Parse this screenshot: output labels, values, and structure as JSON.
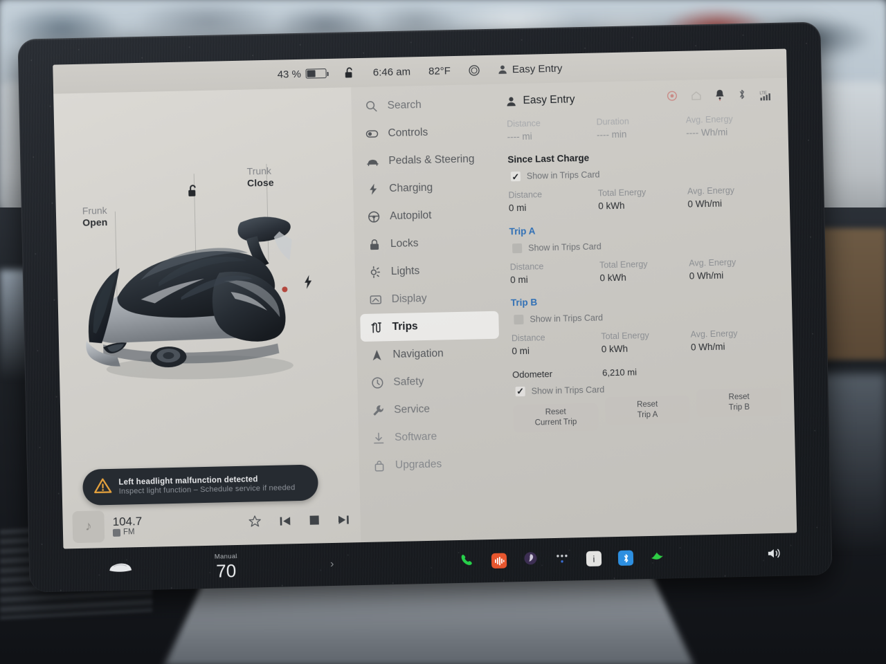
{
  "status_bar": {
    "battery_percent": "43 %",
    "battery_level": 43,
    "lock_icon": "unlocked-padlock-icon",
    "time": "6:46 am",
    "temperature": "82°F",
    "climate_icon": "fan-circle-icon",
    "profile_icon": "person-icon",
    "profile_name": "Easy Entry"
  },
  "left_pane": {
    "frunk": {
      "label_top": "Frunk",
      "label_bottom": "Open"
    },
    "trunk": {
      "label_top": "Trunk",
      "label_bottom": "Close"
    },
    "lock_glyph": "open-padlock-icon",
    "charge_port_icon": "charge-bolt-icon",
    "alert": {
      "icon": "warning-triangle-icon",
      "title": "Left headlight malfunction detected",
      "subtitle": "Inspect light function – Schedule service if needed"
    },
    "media": {
      "album_icon": "music-note-icon",
      "station": "104.7",
      "band": "FM",
      "band_chip_icon": "radio-chip-icon",
      "favorite_icon": "star-outline-icon",
      "previous_icon": "skip-previous-icon",
      "stop_icon": "stop-square-icon",
      "next_icon": "skip-next-icon"
    }
  },
  "menu": {
    "items": [
      {
        "label": "Search",
        "icon": "search-icon",
        "state": "dim",
        "name": "sidebar-item-search"
      },
      {
        "label": "Controls",
        "icon": "toggle-icon",
        "state": "normal",
        "name": "sidebar-item-controls"
      },
      {
        "label": "Pedals & Steering",
        "icon": "car-icon",
        "state": "normal",
        "name": "sidebar-item-pedals-steering"
      },
      {
        "label": "Charging",
        "icon": "bolt-icon",
        "state": "normal",
        "name": "sidebar-item-charging"
      },
      {
        "label": "Autopilot",
        "icon": "steering-wheel-icon",
        "state": "normal",
        "name": "sidebar-item-autopilot"
      },
      {
        "label": "Locks",
        "icon": "lock-icon",
        "state": "normal",
        "name": "sidebar-item-locks"
      },
      {
        "label": "Lights",
        "icon": "headlight-icon",
        "state": "normal",
        "name": "sidebar-item-lights"
      },
      {
        "label": "Display",
        "icon": "display-icon",
        "state": "dim",
        "name": "sidebar-item-display"
      },
      {
        "label": "Trips",
        "icon": "trips-route-icon",
        "state": "active",
        "name": "sidebar-item-trips"
      },
      {
        "label": "Navigation",
        "icon": "navigation-arrow-icon",
        "state": "normal",
        "name": "sidebar-item-navigation"
      },
      {
        "label": "Safety",
        "icon": "safety-icon",
        "state": "dim",
        "name": "sidebar-item-safety"
      },
      {
        "label": "Service",
        "icon": "wrench-icon",
        "state": "dim",
        "name": "sidebar-item-service"
      },
      {
        "label": "Software",
        "icon": "download-icon",
        "state": "dimmer",
        "name": "sidebar-item-software"
      },
      {
        "label": "Upgrades",
        "icon": "bag-icon",
        "state": "dimmer",
        "name": "sidebar-item-upgrades"
      }
    ]
  },
  "trips": {
    "header": {
      "profile_icon": "person-icon",
      "profile_name": "Easy Entry",
      "icons": [
        {
          "name": "dashcam-record-icon",
          "color": "#c98a86"
        },
        {
          "name": "home-icon",
          "color": "#b6b4af"
        },
        {
          "name": "bell-icon",
          "color": "#3a3d41"
        },
        {
          "name": "bluetooth-icon",
          "color": "#5d6064"
        },
        {
          "name": "lte-signal-icon",
          "color": "#4a4d51"
        }
      ]
    },
    "current_trip": {
      "stats": [
        {
          "label": "Distance",
          "value": "---- mi"
        },
        {
          "label": "Duration",
          "value": "---- min"
        },
        {
          "label": "Avg. Energy",
          "value": "---- Wh/mi"
        }
      ]
    },
    "sections": [
      {
        "title": "Since Last Charge",
        "title_style": "plain",
        "checkbox": {
          "label": "Show in Trips Card",
          "checked": true
        },
        "stats": [
          {
            "label": "Distance",
            "value": "0 mi"
          },
          {
            "label": "Total Energy",
            "value": "0 kWh"
          },
          {
            "label": "Avg. Energy",
            "value": "0 Wh/mi"
          }
        ]
      },
      {
        "title": "Trip A",
        "title_style": "link",
        "checkbox": {
          "label": "Show in Trips Card",
          "checked": false
        },
        "stats": [
          {
            "label": "Distance",
            "value": "0 mi"
          },
          {
            "label": "Total Energy",
            "value": "0 kWh"
          },
          {
            "label": "Avg. Energy",
            "value": "0 Wh/mi"
          }
        ]
      },
      {
        "title": "Trip B",
        "title_style": "link",
        "checkbox": {
          "label": "Show in Trips Card",
          "checked": false
        },
        "stats": [
          {
            "label": "Distance",
            "value": "0 mi"
          },
          {
            "label": "Total Energy",
            "value": "0 kWh"
          },
          {
            "label": "Avg. Energy",
            "value": "0 Wh/mi"
          }
        ]
      }
    ],
    "odometer": {
      "label": "Odometer",
      "value": "6,210 mi",
      "checkbox": {
        "label": "Show in Trips Card",
        "checked": true
      }
    },
    "buttons": [
      {
        "line1": "Reset",
        "line2": "Current Trip",
        "name": "reset-current-trip-button"
      },
      {
        "line1": "Reset",
        "line2": "Trip A",
        "name": "reset-trip-a-button"
      },
      {
        "line1": "Reset",
        "line2": "Trip B",
        "name": "reset-trip-b-button"
      }
    ]
  },
  "taskbar": {
    "car_icon": "car-front-icon",
    "climate": {
      "mode": "Manual",
      "temperature": "70",
      "chevron": "›"
    },
    "apps": [
      {
        "name": "phone-icon",
        "glyph": "✆",
        "style": "plain-green"
      },
      {
        "name": "media-app-icon",
        "glyph": "‖",
        "style": "tile-orange"
      },
      {
        "name": "browser-app-icon",
        "glyph": "●",
        "style": "plain-purple"
      },
      {
        "name": "more-apps-icon",
        "glyph": "•••",
        "style": "plain-dots"
      },
      {
        "name": "info-app-icon",
        "glyph": "i",
        "style": "tile-white"
      },
      {
        "name": "bluetooth-app-icon",
        "glyph": "ᛦ",
        "style": "tile-blue"
      },
      {
        "name": "toybox-app-icon",
        "glyph": "✓",
        "style": "plain-green2"
      }
    ],
    "volume_icon": "volume-speaker-icon"
  }
}
